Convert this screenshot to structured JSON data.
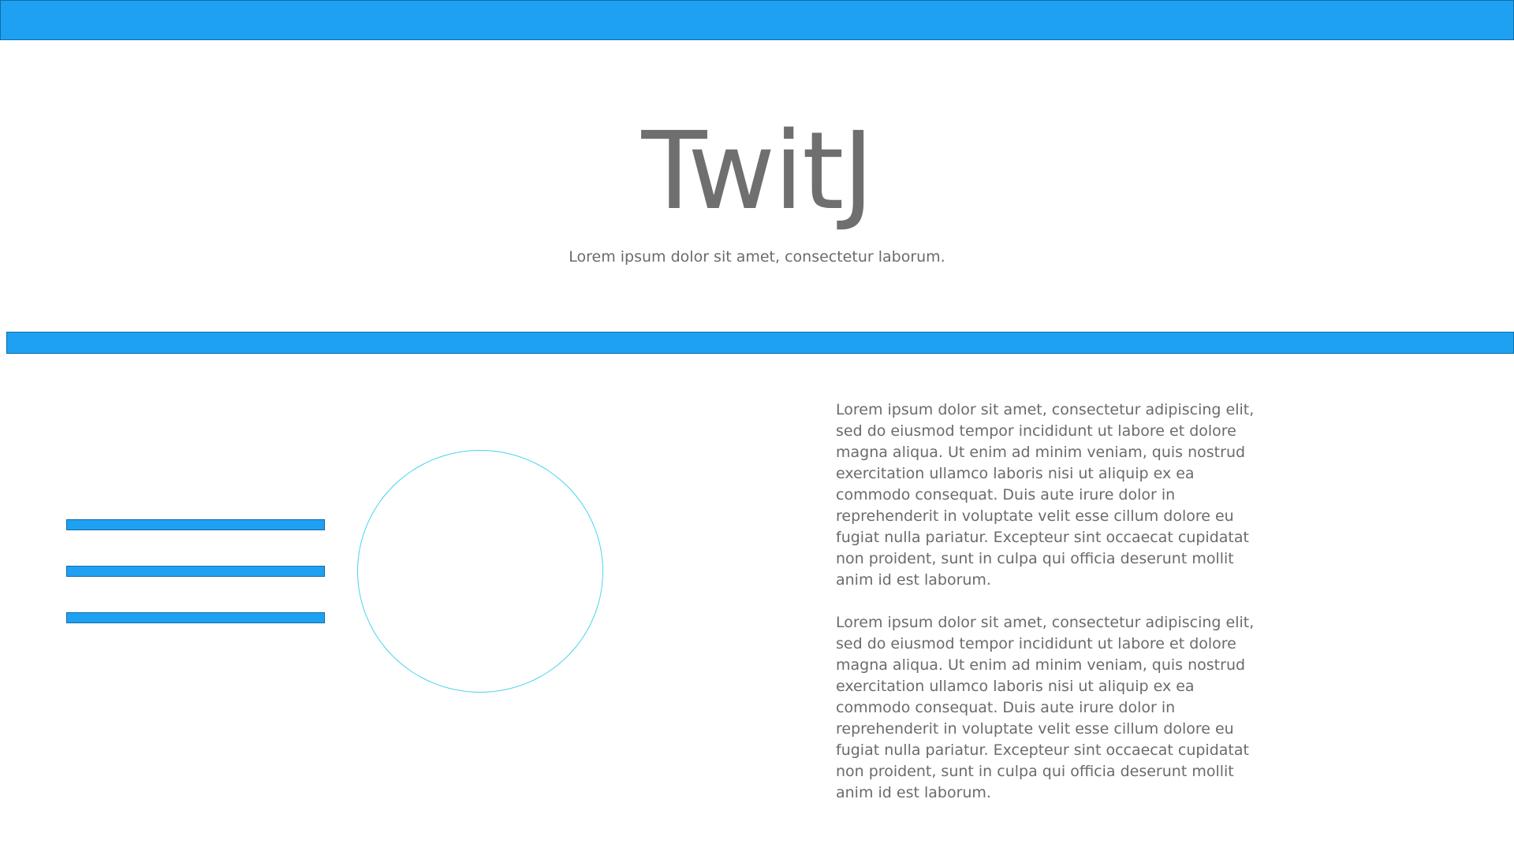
{
  "header": {
    "bar_color": "#1ea1f2"
  },
  "hero": {
    "title": "TwitJ",
    "tagline": "Lorem ipsum dolor sit amet, consectetur  laborum."
  },
  "main": {
    "section_bar_color": "#1ea1f2",
    "circle_border_color": "#47d6ea",
    "paragraphs": [
      "Lorem ipsum dolor sit amet, consectetur adipiscing elit, sed do eiusmod tempor incididunt ut labore et dolore magna aliqua. Ut enim ad minim veniam, quis nostrud exercitation ullamco laboris nisi ut aliquip ex ea commodo consequat. Duis aute irure dolor in reprehenderit in voluptate velit esse cillum dolore eu fugiat nulla pariatur. Excepteur sint occaecat cupidatat non proident, sunt in culpa qui officia deserunt mollit anim id est laborum.",
      "Lorem ipsum dolor sit amet, consectetur adipiscing elit, sed do eiusmod tempor incididunt ut labore et dolore magna aliqua. Ut enim ad minim veniam, quis nostrud exercitation ullamco laboris nisi ut aliquip ex ea commodo consequat. Duis aute irure dolor in reprehenderit in voluptate velit esse cillum dolore eu fugiat nulla pariatur. Excepteur sint occaecat cupidatat non proident, sunt in culpa qui officia deserunt mollit anim id est laborum."
    ]
  }
}
